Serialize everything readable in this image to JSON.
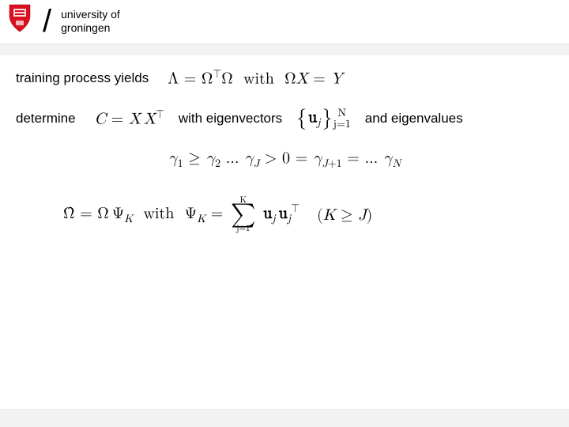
{
  "header": {
    "university_line1": "university of",
    "university_line2": "groningen"
  },
  "line1": {
    "text_a": "training process yields",
    "eq1": "Λ = Ω⊤Ω  with  ΩX = Y"
  },
  "line2": {
    "text_a": "determine",
    "eq_c": "C = X X⊤",
    "text_b": "with eigenvectors",
    "eq_set_pre": "{ 𝐮",
    "eq_set_sub": "j",
    "eq_set_post": " }",
    "eq_set_up": "N",
    "eq_set_low": "j=1",
    "text_c": "and eigenvalues"
  },
  "line3": {
    "eq": "γ₁ ≥ γ₂ … γJ > 0 = γJ+1 = … γN"
  },
  "line4": {
    "lhs": "Ω̂ = Ω ΨK  with  ΨK =",
    "sum_up": "K",
    "sum_low": "j=1",
    "term": "𝐮j 𝐮j⊤",
    "cond": "(K ≥ J)"
  }
}
